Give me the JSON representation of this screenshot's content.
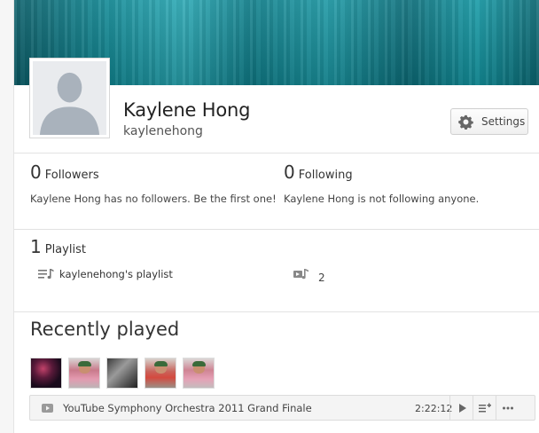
{
  "profile": {
    "name": "Kaylene Hong",
    "username": "kaylenehong",
    "settings_label": "Settings"
  },
  "followers": {
    "count": "0",
    "label": "Followers",
    "note": "Kaylene Hong has no followers. Be the first one!"
  },
  "following": {
    "count": "0",
    "label": "Following",
    "note": "Kaylene Hong is not following anyone."
  },
  "playlists": {
    "count": "1",
    "label": "Playlist",
    "items": [
      {
        "name": "kaylenehong's playlist",
        "track_count": "2"
      }
    ]
  },
  "recently_played": {
    "title": "Recently played",
    "track": {
      "title": "YouTube Symphony Orchestra 2011 Grand Finale",
      "duration": "2:22:12"
    }
  },
  "colors": {
    "banner": "#118a96",
    "accent": "#2aa8b4"
  }
}
